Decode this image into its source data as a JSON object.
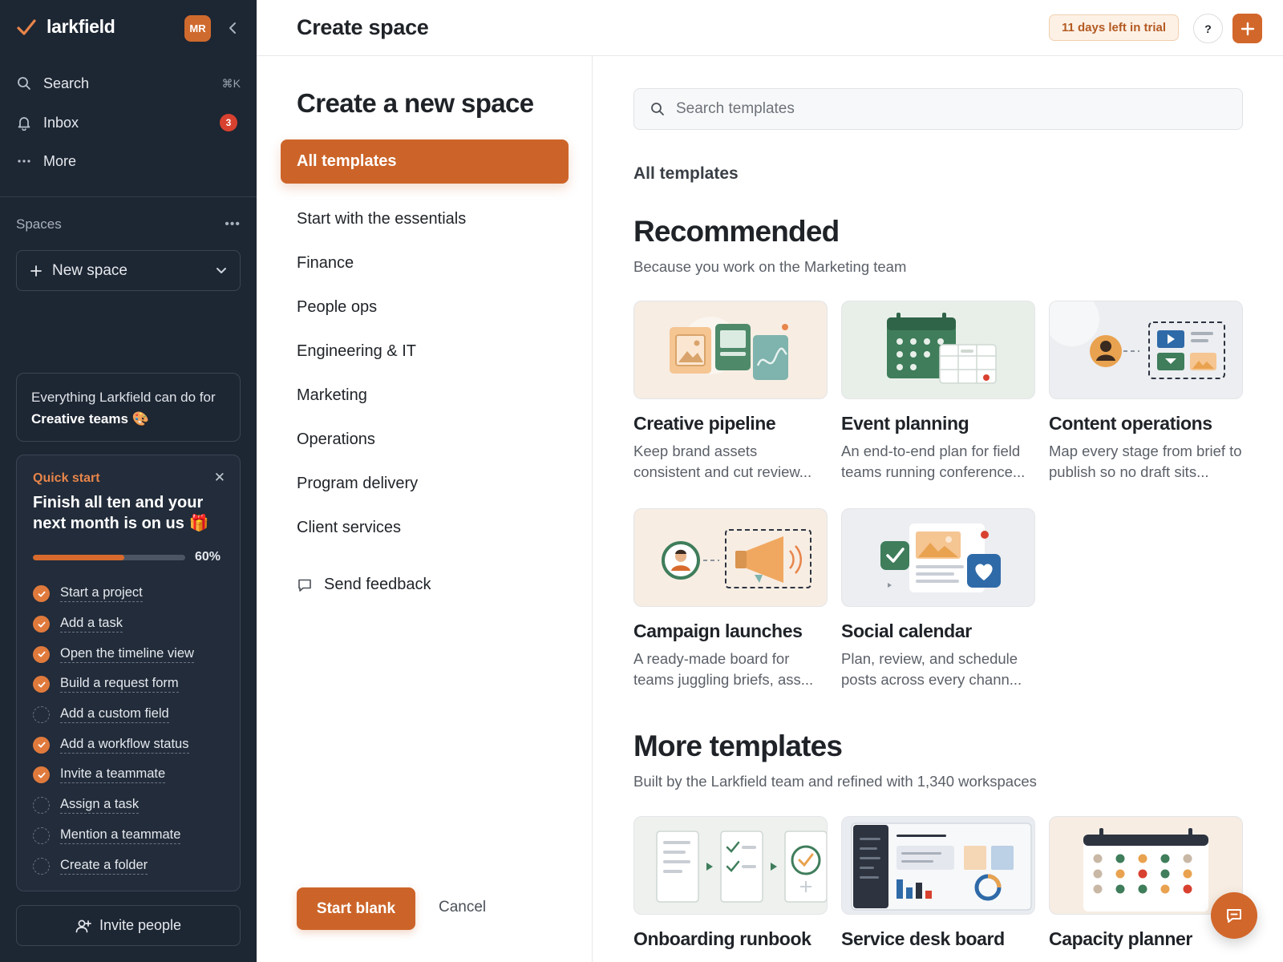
{
  "sidebar": {
    "brand": "larkfield",
    "avatar_initials": "MR",
    "nav": {
      "search": "Search",
      "search_shortcut": "⌘K",
      "inbox": "Inbox",
      "inbox_count": "3",
      "more": "More"
    },
    "spaces_label": "Spaces",
    "new_space": "New space",
    "promo": {
      "text": "Everything Larkfield can do for",
      "bold": "Creative teams",
      "emoji": "🎨"
    },
    "quick_start": {
      "label": "Quick start",
      "title": "Finish all ten and your next month is on us 🎁",
      "progress": 0.6,
      "progress_label": "60%",
      "tasks": [
        {
          "label": "Start a project",
          "done": true
        },
        {
          "label": "Add a task",
          "done": true
        },
        {
          "label": "Open the timeline view",
          "done": true
        },
        {
          "label": "Build a request form",
          "done": true
        },
        {
          "label": "Add a custom field",
          "done": false
        },
        {
          "label": "Add a workflow status",
          "done": true
        },
        {
          "label": "Invite a teammate",
          "done": true
        },
        {
          "label": "Assign a task",
          "done": false
        },
        {
          "label": "Mention a teammate",
          "done": false
        },
        {
          "label": "Create a folder",
          "done": false
        }
      ]
    },
    "invite": "Invite people"
  },
  "header": {
    "title": "Create space",
    "trial": "11 days left in trial",
    "help": "?"
  },
  "categories": {
    "title": "Create a new space",
    "active": "All templates",
    "items": [
      "Start with the essentials",
      "Finance",
      "People ops",
      "Engineering & IT",
      "Marketing",
      "Operations",
      "Program delivery",
      "Client services"
    ],
    "feedback": "Send feedback",
    "start_blank": "Start blank",
    "cancel": "Cancel"
  },
  "templates": {
    "search_placeholder": "Search templates",
    "all_label": "All templates",
    "recommended": {
      "title": "Recommended",
      "subtitle": "Because you work on the Marketing team",
      "cards": [
        {
          "title": "Creative pipeline",
          "desc": "Keep brand assets consistent and cut review..."
        },
        {
          "title": "Event planning",
          "desc": "An end-to-end plan for field teams running conference..."
        },
        {
          "title": "Content operations",
          "desc": "Map every stage from brief to publish so no draft sits..."
        },
        {
          "title": "Campaign launches",
          "desc": "A ready-made board for teams juggling briefs, ass..."
        },
        {
          "title": "Social calendar",
          "desc": "Plan, review, and schedule posts across every chann..."
        }
      ]
    },
    "more": {
      "title": "More templates",
      "subtitle": "Built by the Larkfield team and refined with 1,340 workspaces",
      "cards": [
        {
          "title": "Onboarding runbook",
          "desc": ""
        },
        {
          "title": "Service desk board",
          "desc": ""
        },
        {
          "title": "Capacity planner",
          "desc": ""
        }
      ]
    }
  },
  "colors": {
    "accent": "#cc6429",
    "sidebar_bg": "#1d2633",
    "check_done": "#e07a3c",
    "badge_red": "#d8412f"
  }
}
